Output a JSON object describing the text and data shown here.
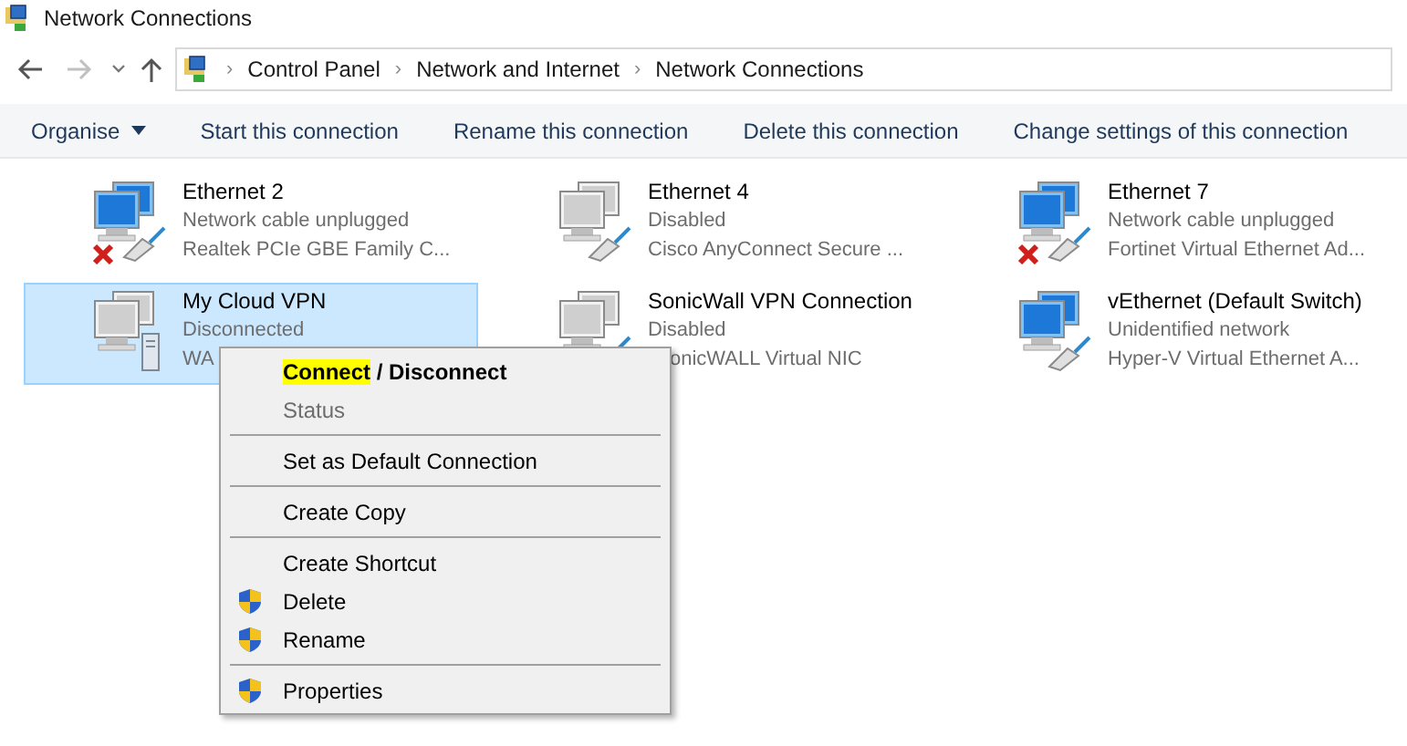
{
  "window": {
    "title": "Network Connections"
  },
  "navigation": {
    "back_disabled": false,
    "forward_disabled": true
  },
  "breadcrumb_separator": "›",
  "breadcrumb": [
    "Control Panel",
    "Network and Internet",
    "Network Connections"
  ],
  "toolbar": [
    {
      "label": "Organise",
      "kind": "dropdown"
    },
    {
      "label": "Start this connection",
      "kind": "button"
    },
    {
      "label": "Rename this connection",
      "kind": "button"
    },
    {
      "label": "Delete this connection",
      "kind": "button"
    },
    {
      "label": "Change settings of this connection",
      "kind": "button"
    }
  ],
  "connections": [
    {
      "name": "Ethernet 2",
      "status": "Network cable unplugged",
      "adapter": "Realtek PCIe GBE Family C...",
      "kind": "ethernet",
      "active": true,
      "unplugged": true,
      "selected": false,
      "adapter_covered_left": false
    },
    {
      "name": "Ethernet 4",
      "status": "Disabled",
      "adapter": "Cisco AnyConnect Secure ...",
      "kind": "ethernet",
      "active": false,
      "unplugged": false,
      "selected": false,
      "adapter_covered_left": false
    },
    {
      "name": "Ethernet 7",
      "status": "Network cable unplugged",
      "adapter": "Fortinet Virtual Ethernet Ad...",
      "kind": "ethernet",
      "active": true,
      "unplugged": true,
      "selected": false,
      "adapter_covered_left": false
    },
    {
      "name": "My Cloud VPN",
      "status": "Disconnected",
      "adapter": "WA",
      "kind": "vpn",
      "active": false,
      "unplugged": false,
      "selected": true,
      "adapter_covered_left": false
    },
    {
      "name": "SonicWall VPN Connection",
      "status": "Disabled",
      "adapter": "onicWALL Virtual NIC",
      "kind": "ethernet",
      "active": false,
      "unplugged": false,
      "selected": false,
      "adapter_covered_left": true
    },
    {
      "name": "vEthernet (Default Switch)",
      "status": "Unidentified network",
      "adapter": "Hyper-V Virtual Ethernet A...",
      "kind": "ethernet",
      "active": true,
      "unplugged": false,
      "selected": false,
      "adapter_covered_left": false
    }
  ],
  "context_menu": [
    {
      "kind": "item",
      "parts": [
        {
          "text": "Connect",
          "highlighted": true
        },
        {
          "text": " / Disconnect",
          "highlighted": false
        }
      ],
      "bold": true,
      "disabled": false,
      "shield": false
    },
    {
      "kind": "item",
      "parts": [
        {
          "text": "Status",
          "highlighted": false
        }
      ],
      "bold": false,
      "disabled": true,
      "shield": false
    },
    {
      "kind": "separator"
    },
    {
      "kind": "item",
      "parts": [
        {
          "text": "Set as Default Connection",
          "highlighted": false
        }
      ],
      "bold": false,
      "disabled": false,
      "shield": false
    },
    {
      "kind": "separator"
    },
    {
      "kind": "item",
      "parts": [
        {
          "text": "Create Copy",
          "highlighted": false
        }
      ],
      "bold": false,
      "disabled": false,
      "shield": false
    },
    {
      "kind": "separator"
    },
    {
      "kind": "item",
      "parts": [
        {
          "text": "Create Shortcut",
          "highlighted": false
        }
      ],
      "bold": false,
      "disabled": false,
      "shield": false
    },
    {
      "kind": "item",
      "parts": [
        {
          "text": "Delete",
          "highlighted": false
        }
      ],
      "bold": false,
      "disabled": false,
      "shield": true
    },
    {
      "kind": "item",
      "parts": [
        {
          "text": "Rename",
          "highlighted": false
        }
      ],
      "bold": false,
      "disabled": false,
      "shield": true
    },
    {
      "kind": "separator"
    },
    {
      "kind": "item",
      "parts": [
        {
          "text": "Properties",
          "highlighted": false
        }
      ],
      "bold": false,
      "disabled": false,
      "shield": true
    }
  ]
}
